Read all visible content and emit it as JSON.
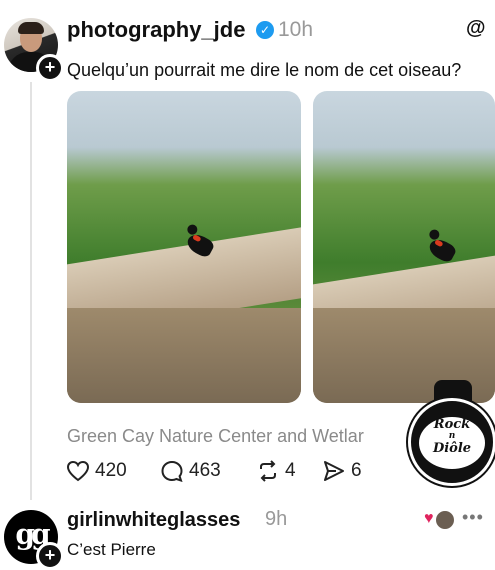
{
  "post": {
    "username": "photography_jde",
    "time": "10h",
    "text": "Quelqu’un pourrait me dire le nom de cet oiseau?",
    "caption": "Green Cay Nature Center and Wetlar",
    "actions": {
      "likes": "420",
      "replies": "463",
      "reposts": "4",
      "shares": "6"
    },
    "icons": {
      "threads": "threads-logo-icon",
      "like": "heart-icon",
      "reply": "comment-icon",
      "repost": "repost-icon",
      "share": "send-icon",
      "verified": "verified-check-icon",
      "add": "plus-icon"
    },
    "watermark": {
      "line1": "Rock",
      "line2": "n",
      "line3": "Diôle"
    }
  },
  "reply": {
    "username": "girlinwhiteglasses",
    "time": "9h",
    "text": "C’est Pierre",
    "avatar_text": "gg",
    "more_label": "•••"
  },
  "colors": {
    "verified": "#1d9bf0",
    "muted_text": "#999999",
    "heart": "#e0245e"
  }
}
